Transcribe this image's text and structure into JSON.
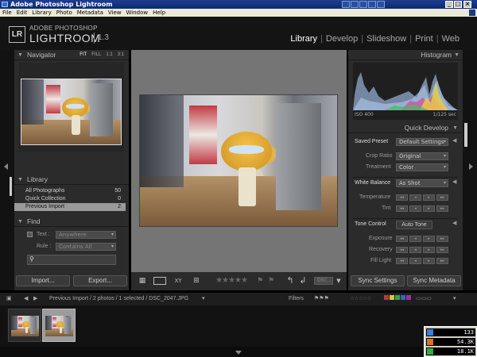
{
  "window": {
    "title": "Adobe Photoshop Lightroom"
  },
  "menu": [
    "File",
    "Edit",
    "Library",
    "Photo",
    "Metadata",
    "View",
    "Window",
    "Help"
  ],
  "header": {
    "logo": "LR",
    "brand_top": "ADOBE PHOTOSHOP",
    "brand_main": "LIGHTROOM",
    "version": "1.3",
    "modules": [
      "Library",
      "Develop",
      "Slideshow",
      "Print",
      "Web"
    ],
    "active_module": "Library"
  },
  "navigator": {
    "title": "Navigator",
    "options": [
      "FIT",
      "FILL",
      "1:1",
      "3:1"
    ],
    "active_option": "FIT"
  },
  "library": {
    "title": "Library",
    "items": [
      {
        "label": "All Photographs",
        "count": "50"
      },
      {
        "label": "Quick Collection",
        "count": "0"
      },
      {
        "label": "Previous Import",
        "count": "2"
      }
    ],
    "selected": "Previous Import"
  },
  "find": {
    "title": "Find",
    "text_label": "Text :",
    "text_value": "Anywhere",
    "rule_label": "Rule :",
    "rule_value": "Contains All"
  },
  "left_buttons": {
    "import": "Import...",
    "export": "Export..."
  },
  "histogram": {
    "title": "Histogram",
    "iso": "ISO 400",
    "shutter": "1/125 sec"
  },
  "quick_develop": {
    "title": "Quick Develop",
    "saved_preset_label": "Saved Preset",
    "saved_preset_value": "Default Settings",
    "crop_ratio_label": "Crop Ratio",
    "crop_ratio_value": "Original",
    "treatment_label": "Treatment",
    "treatment_value": "Color",
    "white_balance_label": "White Balance",
    "white_balance_value": "As Shot",
    "temperature_label": "Temperature",
    "tint_label": "Tint",
    "tone_control_label": "Tone Control",
    "auto_tone_label": "Auto Tone",
    "exposure_label": "Exposure",
    "recovery_label": "Recovery",
    "fill_light_label": "Fill Light"
  },
  "right_buttons": {
    "sync_settings": "Sync Settings",
    "sync_metadata": "Sync Metadata"
  },
  "toolbar": {
    "sort_label": "DSC..."
  },
  "filmbar": {
    "path": "Previous Import / 2 photos / 1 selected / DSC_2047.JPG",
    "filters_label": "Filters"
  },
  "netmon": {
    "row1": "133",
    "row2": "54.3K",
    "row3": "18.1K"
  },
  "colors": {
    "panel": "#2b2b2b",
    "workspace": "#757575",
    "selected_row": "#9a9a9a"
  }
}
